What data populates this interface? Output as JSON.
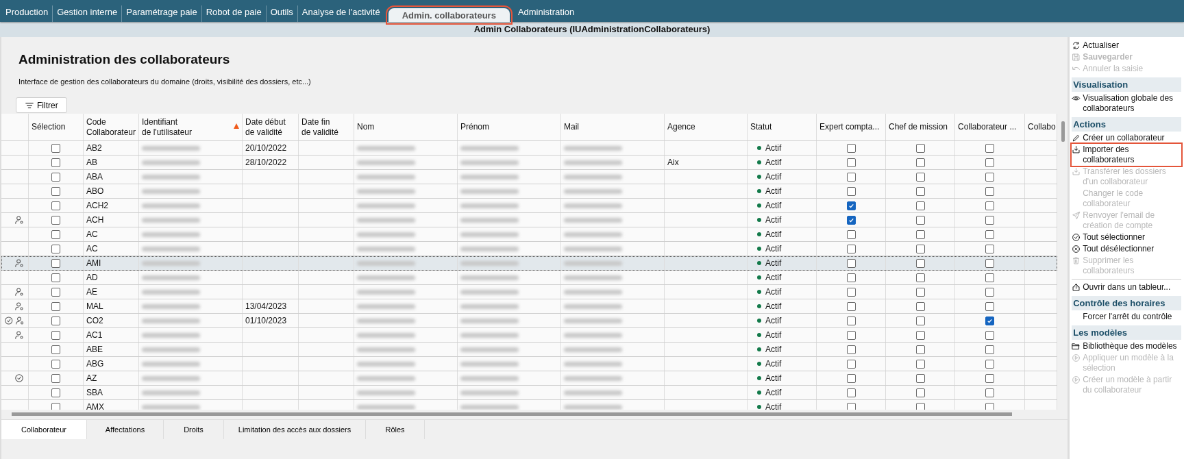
{
  "nav": {
    "tabs": [
      {
        "label": "Production",
        "selected": false
      },
      {
        "label": "Gestion interne",
        "selected": false
      },
      {
        "label": "Paramétrage paie",
        "selected": false
      },
      {
        "label": "Robot de paie",
        "selected": false
      },
      {
        "label": "Outils",
        "selected": false
      },
      {
        "label": "Analyse de l'activité",
        "selected": false
      },
      {
        "label": "Admin. collaborateurs",
        "selected": true,
        "highlighted": true
      },
      {
        "label": "Administration",
        "selected": false
      }
    ]
  },
  "title_bar": {
    "title": "Admin Collaborateurs (IUAdministrationCollaborateurs)"
  },
  "page": {
    "heading": "Administration des collaborateurs",
    "description": "Interface de gestion des collaborateurs du domaine (droits, visibilité des dossiers, etc...)",
    "filter_button": "Filtrer"
  },
  "table": {
    "columns": [
      {
        "kind": "icons"
      },
      {
        "kind": "checkbox",
        "label": "Sélection"
      },
      {
        "kind": "text",
        "label": "Code\nCollaborateur"
      },
      {
        "kind": "redacted",
        "label": "Identifiant\nde l'utilisateur",
        "sorted": true
      },
      {
        "kind": "text",
        "label": "Date début\nde validité"
      },
      {
        "kind": "text",
        "label": "Date fin\nde validité"
      },
      {
        "kind": "redacted",
        "label": "Nom"
      },
      {
        "kind": "redacted",
        "label": "Prénom"
      },
      {
        "kind": "redacted",
        "label": "Mail"
      },
      {
        "kind": "text",
        "label": "Agence"
      },
      {
        "kind": "status",
        "label": "Statut"
      },
      {
        "kind": "checkbox",
        "label": "Expert compta..."
      },
      {
        "kind": "checkbox",
        "label": "Chef de mission"
      },
      {
        "kind": "checkbox",
        "label": "Collaborateur ..."
      },
      {
        "kind": "text",
        "label": "Collabo"
      }
    ],
    "rows": [
      {
        "selected": false,
        "validated": false,
        "managed": false,
        "selection": false,
        "code": "AB2",
        "date_start": "20/10/2022",
        "status": "Actif",
        "expert": false,
        "chef": false,
        "collab": false
      },
      {
        "selected": false,
        "validated": false,
        "managed": false,
        "selection": false,
        "code": "AB",
        "date_start": "28/10/2022",
        "agency": "Aix",
        "status": "Actif",
        "expert": false,
        "chef": false,
        "collab": false
      },
      {
        "selected": false,
        "validated": false,
        "managed": false,
        "selection": false,
        "code": "ABA",
        "status": "Actif",
        "expert": false,
        "chef": false,
        "collab": false
      },
      {
        "selected": false,
        "validated": false,
        "managed": false,
        "selection": false,
        "code": "ABO",
        "status": "Actif",
        "expert": false,
        "chef": false,
        "collab": false
      },
      {
        "selected": false,
        "validated": false,
        "managed": false,
        "selection": false,
        "code": "ACH2",
        "status": "Actif",
        "expert": true,
        "chef": false,
        "collab": false
      },
      {
        "selected": false,
        "validated": false,
        "managed": true,
        "selection": false,
        "code": "ACH",
        "status": "Actif",
        "expert": true,
        "chef": false,
        "collab": false
      },
      {
        "selected": false,
        "validated": false,
        "managed": false,
        "selection": false,
        "code": "AC",
        "status": "Actif",
        "expert": false,
        "chef": false,
        "collab": false
      },
      {
        "selected": false,
        "validated": false,
        "managed": false,
        "selection": false,
        "code": "AC",
        "status": "Actif",
        "expert": false,
        "chef": false,
        "collab": false
      },
      {
        "selected": true,
        "validated": false,
        "managed": true,
        "selection": false,
        "code": "AMI",
        "status": "Actif",
        "expert": false,
        "chef": false,
        "collab": false
      },
      {
        "selected": false,
        "validated": false,
        "managed": false,
        "selection": false,
        "code": "AD",
        "status": "Actif",
        "expert": false,
        "chef": false,
        "collab": false
      },
      {
        "selected": false,
        "validated": false,
        "managed": true,
        "selection": false,
        "code": "AE",
        "status": "Actif",
        "expert": false,
        "chef": false,
        "collab": false
      },
      {
        "selected": false,
        "validated": false,
        "managed": true,
        "selection": false,
        "code": "MAL",
        "date_start": "13/04/2023",
        "status": "Actif",
        "expert": false,
        "chef": false,
        "collab": false
      },
      {
        "selected": false,
        "validated": true,
        "managed": true,
        "selection": false,
        "code": "CO2",
        "date_start": "01/10/2023",
        "status": "Actif",
        "expert": false,
        "chef": false,
        "collab": true
      },
      {
        "selected": false,
        "validated": false,
        "managed": true,
        "selection": false,
        "code": "AC1",
        "status": "Actif",
        "expert": false,
        "chef": false,
        "collab": false
      },
      {
        "selected": false,
        "validated": false,
        "managed": false,
        "selection": false,
        "code": "ABE",
        "status": "Actif",
        "expert": false,
        "chef": false,
        "collab": false
      },
      {
        "selected": false,
        "validated": false,
        "managed": false,
        "selection": false,
        "code": "ABG",
        "status": "Actif",
        "expert": false,
        "chef": false,
        "collab": false
      },
      {
        "selected": false,
        "validated": true,
        "managed": false,
        "selection": false,
        "code": "AZ",
        "status": "Actif",
        "expert": false,
        "chef": false,
        "collab": false
      },
      {
        "selected": false,
        "validated": false,
        "managed": false,
        "selection": false,
        "code": "SBA",
        "status": "Actif",
        "expert": false,
        "chef": false,
        "collab": false
      },
      {
        "selected": false,
        "validated": false,
        "managed": false,
        "selection": false,
        "code": "AMX",
        "status": "Actif",
        "expert": false,
        "chef": false,
        "collab": false
      }
    ]
  },
  "bottom_tabs": [
    {
      "label": "Collaborateur",
      "selected": true
    },
    {
      "label": "Affectations",
      "selected": false
    },
    {
      "label": "Droits",
      "selected": false
    },
    {
      "label": "Limitation des accès aux dossiers",
      "selected": false
    },
    {
      "label": "Rôles",
      "selected": false
    }
  ],
  "sidebar": {
    "items": [
      {
        "kind": "action",
        "label": "Actualiser",
        "disabled": false
      },
      {
        "kind": "action",
        "label": "Sauvegarder",
        "disabled": true,
        "bold": true
      },
      {
        "kind": "action",
        "label": "Annuler la saisie",
        "disabled": true
      },
      {
        "kind": "section",
        "label": "Visualisation"
      },
      {
        "kind": "action",
        "label": "Visualisation globale des collaborateurs",
        "disabled": false
      },
      {
        "kind": "section",
        "label": "Actions"
      },
      {
        "kind": "action",
        "label": "Créer un collaborateur",
        "disabled": false
      },
      {
        "kind": "action",
        "label": "Importer des collaborateurs",
        "disabled": false,
        "highlighted": true
      },
      {
        "kind": "action",
        "label": "Transférer les dossiers d'un collaborateur",
        "disabled": true
      },
      {
        "kind": "action",
        "label": "Changer le code collaborateur",
        "disabled": true
      },
      {
        "kind": "action",
        "label": "Renvoyer l'email de création de compte",
        "disabled": true
      },
      {
        "kind": "action",
        "label": "Tout sélectionner",
        "disabled": false
      },
      {
        "kind": "action",
        "label": "Tout désélectionner",
        "disabled": false
      },
      {
        "kind": "action",
        "label": "Supprimer les collaborateurs",
        "disabled": true
      },
      {
        "kind": "separator"
      },
      {
        "kind": "action",
        "label": "Ouvrir dans un tableur...",
        "disabled": false
      },
      {
        "kind": "section",
        "label": "Contrôle des horaires"
      },
      {
        "kind": "action",
        "label": "Forcer l'arrêt du contrôle",
        "disabled": false
      },
      {
        "kind": "section",
        "label": "Les modèles"
      },
      {
        "kind": "action",
        "label": "Bibliothèque des modèles",
        "disabled": false
      },
      {
        "kind": "action",
        "label": "Appliquer un modèle à la sélection",
        "disabled": true
      },
      {
        "kind": "action",
        "label": "Créer un modèle à partir du collaborateur",
        "disabled": true
      }
    ]
  }
}
